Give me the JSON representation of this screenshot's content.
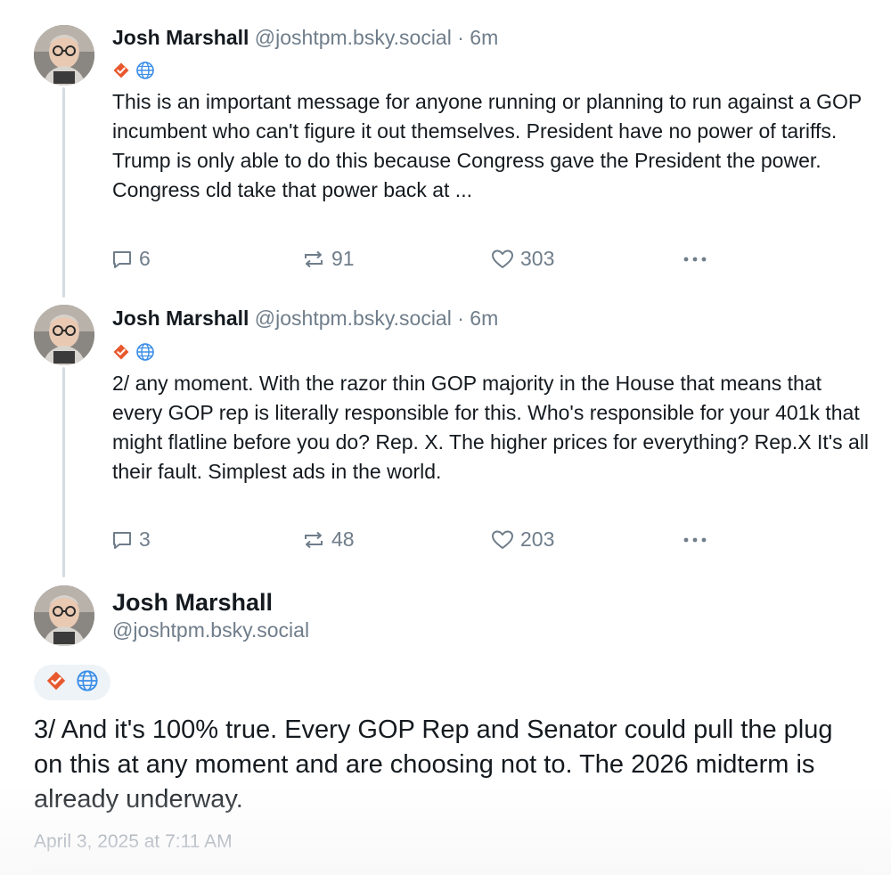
{
  "posts": [
    {
      "author_name": "Josh Marshall",
      "handle": "@joshtpm.bsky.social",
      "time": "· 6m",
      "text": "This is an important message for anyone running or planning to run against a GOP incumbent who can't figure it out themselves. President have no power of tariffs. Trump is only able to do this because Congress gave the President the power. Congress cld take that power back at ...",
      "replies": "6",
      "reposts": "91",
      "likes": "303"
    },
    {
      "author_name": "Josh Marshall",
      "handle": "@joshtpm.bsky.social",
      "time": "· 6m",
      "text": "2/ any moment. With the razor thin GOP majority in the House that means that every GOP rep is literally responsible for this. Who's responsible for your 401k that might flatline before you do? Rep. X. The higher prices for everything? Rep.X It's all their fault. Simplest ads in the world.",
      "replies": "3",
      "reposts": "48",
      "likes": "203"
    }
  ],
  "main_post": {
    "author_name": "Josh Marshall",
    "handle": "@joshtpm.bsky.social",
    "text": "3/ And it's 100% true. Every GOP Rep and Senator could pull the plug on this at any moment and are choosing not to. The 2026 midterm is already underway.",
    "timestamp": "April 3, 2025 at 7:11 AM"
  },
  "colors": {
    "text": "#141a1f",
    "muted": "#6f7d8a",
    "verified_badge": "#e8582e",
    "globe_badge": "#3b8ee8",
    "thread_line": "#d4dbe2"
  },
  "icons": {
    "verified": "verified-check-icon",
    "globe": "globe-icon",
    "reply": "reply-icon",
    "repost": "repost-icon",
    "like": "heart-icon",
    "more": "more-options-icon"
  }
}
